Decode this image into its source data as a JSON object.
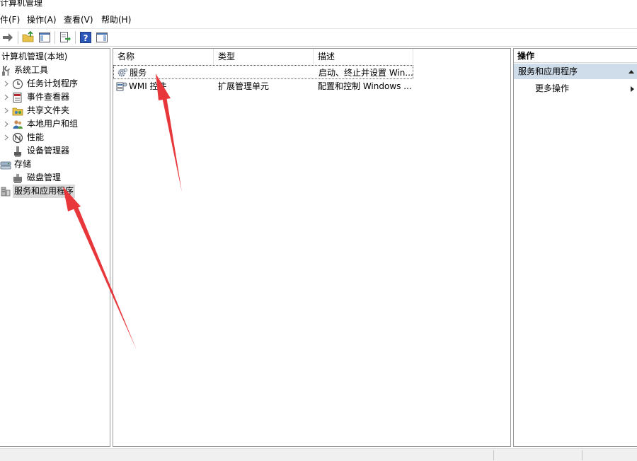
{
  "window": {
    "title": "计算机管理",
    "controls": {
      "minimize": "minimize-icon",
      "maximize": "maximize-icon",
      "close": "close-icon"
    }
  },
  "menu": {
    "items": [
      {
        "label": "件(F)"
      },
      {
        "label": "操作(A)"
      },
      {
        "label": "查看(V)"
      },
      {
        "label": "帮助(H)"
      }
    ]
  },
  "toolbar": {
    "buttons": [
      "forward-arrow-icon",
      "up-folder-icon",
      "show-hide-tree-icon",
      "export-list-icon",
      "help-icon",
      "properties-pane-icon"
    ]
  },
  "tree": {
    "root": "计算机管理(本地)",
    "items": [
      {
        "label": "系统工具",
        "icon": "tools-icon",
        "level": 0,
        "expandable": false
      },
      {
        "label": "任务计划程序",
        "icon": "clock-icon",
        "level": 1,
        "expandable": true
      },
      {
        "label": "事件查看器",
        "icon": "event-viewer-icon",
        "level": 1,
        "expandable": true
      },
      {
        "label": "共享文件夹",
        "icon": "shared-folder-icon",
        "level": 1,
        "expandable": true
      },
      {
        "label": "本地用户和组",
        "icon": "users-icon",
        "level": 1,
        "expandable": true
      },
      {
        "label": "性能",
        "icon": "performance-icon",
        "level": 1,
        "expandable": true
      },
      {
        "label": "设备管理器",
        "icon": "device-manager-icon",
        "level": 1,
        "expandable": false
      },
      {
        "label": "存储",
        "icon": "storage-icon",
        "level": 0,
        "expandable": false
      },
      {
        "label": "磁盘管理",
        "icon": "disk-icon",
        "level": 1,
        "expandable": false
      },
      {
        "label": "服务和应用程序",
        "icon": "services-apps-icon",
        "level": 0,
        "expandable": false,
        "selected": true
      }
    ]
  },
  "list": {
    "columns": [
      "名称",
      "类型",
      "描述"
    ],
    "rows": [
      {
        "name": "服务",
        "type": "",
        "desc": "启动、终止并设置 Win...",
        "icon": "services-gear-icon"
      },
      {
        "name": "WMI 控件",
        "type": "扩展管理单元",
        "desc": "配置和控制 Windows ...",
        "icon": "wmi-control-icon"
      }
    ]
  },
  "actions": {
    "header": "操作",
    "section": "服务和应用程序",
    "more": "更多操作"
  },
  "colors": {
    "selection_gray": "#d9d9d9",
    "actions_section_bg": "#cfdcea",
    "annotation_red": "#e8373a"
  }
}
